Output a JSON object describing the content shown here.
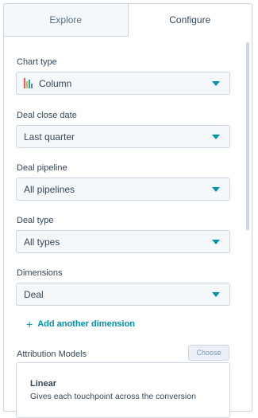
{
  "tabs": {
    "explore": "Explore",
    "configure": "Configure",
    "active": "configure"
  },
  "fields": {
    "chart_type": {
      "label": "Chart type",
      "value": "Column",
      "icon": "column-chart-icon"
    },
    "deal_close_date": {
      "label": "Deal close date",
      "value": "Last quarter"
    },
    "deal_pipeline": {
      "label": "Deal pipeline",
      "value": "All pipelines"
    },
    "deal_type": {
      "label": "Deal type",
      "value": "All types"
    },
    "dimensions": {
      "label": "Dimensions",
      "value": "Deal"
    }
  },
  "add_dimension": "Add another dimension",
  "attribution": {
    "label": "Attribution Models",
    "choose": "Choose",
    "model_name": "Linear",
    "model_desc": "Gives each touchpoint across the conversion"
  },
  "colors": {
    "accent": "#0091ae",
    "text": "#33475b",
    "border": "#cbd6e2",
    "input_bg": "#f5f8fa",
    "chart_icon": [
      "#f2545b",
      "#ffa43b",
      "#00bda5",
      "#6a78d1"
    ]
  }
}
